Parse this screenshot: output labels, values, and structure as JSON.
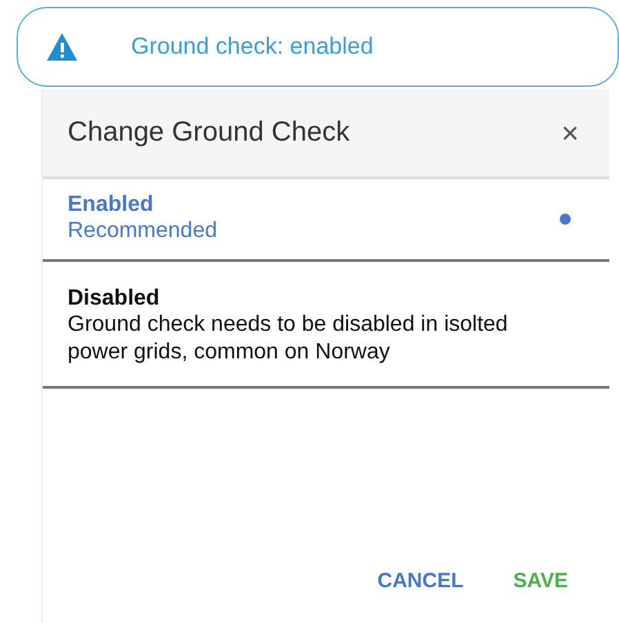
{
  "banner": {
    "message": "Ground check: enabled"
  },
  "dialog": {
    "title": "Change Ground Check",
    "close": "×",
    "options": [
      {
        "label": "Enabled",
        "description": "Recommended",
        "selected": true
      },
      {
        "label": "Disabled",
        "description": "Ground check needs to be disabled in isolted power grids, common on Norway",
        "selected": false
      }
    ],
    "buttons": [
      {
        "label": "CANCEL",
        "kind": "cancel"
      },
      {
        "label": "SAVE",
        "kind": "save"
      }
    ]
  }
}
